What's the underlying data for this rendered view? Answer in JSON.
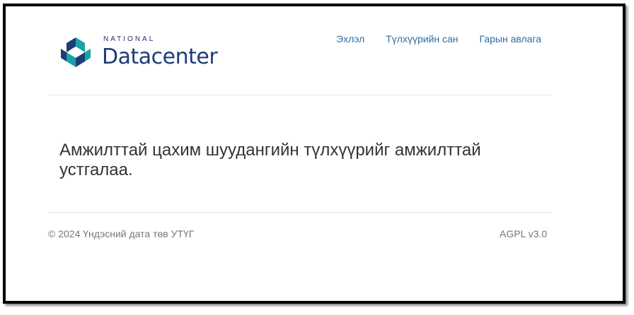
{
  "header": {
    "logo": {
      "small_text": "NATIONAL",
      "main_text": "Datacenter"
    },
    "nav": [
      {
        "label": "Эхлэл"
      },
      {
        "label": "Түлхүүрийн сан"
      },
      {
        "label": "Гарын авлага"
      }
    ]
  },
  "main": {
    "message": "Амжилттай цахим шуудангийн түлхүүрийг амжилттай устгалаа."
  },
  "footer": {
    "copyright": "© 2024 Үндэсний дата төв УТҮГ",
    "license": "AGPL v3.0"
  },
  "colors": {
    "link": "#2e6da4",
    "logo_blue": "#1d3c78",
    "logo_teal": "#1aa3a3",
    "text": "#333333",
    "muted": "#777777"
  },
  "icons": {
    "logo": "national-datacenter-logo-icon"
  }
}
